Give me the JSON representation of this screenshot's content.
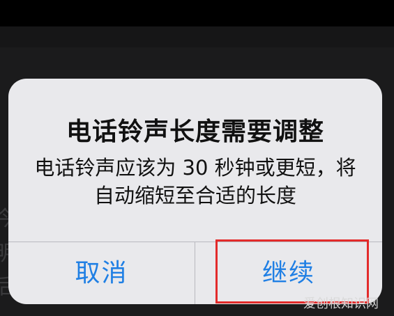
{
  "background": {
    "fragments": [
      "今",
      "明",
      "后"
    ]
  },
  "dialog": {
    "title": "电话铃声长度需要调整",
    "message": "电话铃声应该为 30 秒钟或更短，将自动缩短至合适的长度",
    "cancel_label": "取消",
    "continue_label": "继续"
  },
  "overlay": {
    "watermark": "爱创根知识网"
  },
  "colors": {
    "accent": "#1f7fe4",
    "highlight": "#e32b2b"
  }
}
